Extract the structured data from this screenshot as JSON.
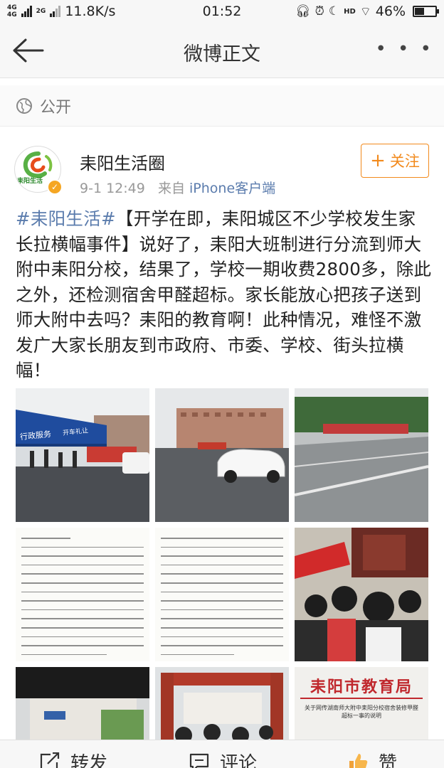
{
  "status_bar": {
    "signal_1": "4G",
    "signal_1b": "4G",
    "signal_2": "2G",
    "net_speed": "11.8K/s",
    "time": "01:52",
    "hd_label": "HD",
    "battery_percent": "46%",
    "battery_level": 0.46
  },
  "nav": {
    "title": "微博正文",
    "more": "• • •"
  },
  "visibility": {
    "label": "公开"
  },
  "post": {
    "author": "耒阳生活圈",
    "avatar_text": "耒阳生活",
    "time": "9-1 12:49",
    "source_prefix": "来自",
    "source": "iPhone客户端",
    "follow_plus": "+",
    "follow_label": "关注",
    "topic": "#耒阳生活#",
    "text": "【开学在即，耒阳城区不少学校发生家长拉横幅事件】说好了，耒阳大班制进行分流到师大附中耒阳分校，结果了，学校一期收费2800多，除此之外，还检测宿舍甲醛超标。家长能放心把孩子送到师大附中去吗？耒阳的教育啊！此种情况，难怪不激发广大家长朋友到市政府、市委、学校、街头拉横幅！"
  },
  "images": {
    "banner_text_1": "行政服务",
    "banner_text_2": "开车礼让",
    "notice_heading": "耒阳市教育局",
    "notice_sub": "关于网传湖南师大附中耒阳分校宿舍装修甲醛超标一事的说明"
  },
  "actions": {
    "repost": "转发",
    "comment": "评论",
    "like": "赞"
  },
  "colors": {
    "link": "#5b7cad",
    "follow_orange": "#f28a1c",
    "notice_red": "#c0282d"
  }
}
